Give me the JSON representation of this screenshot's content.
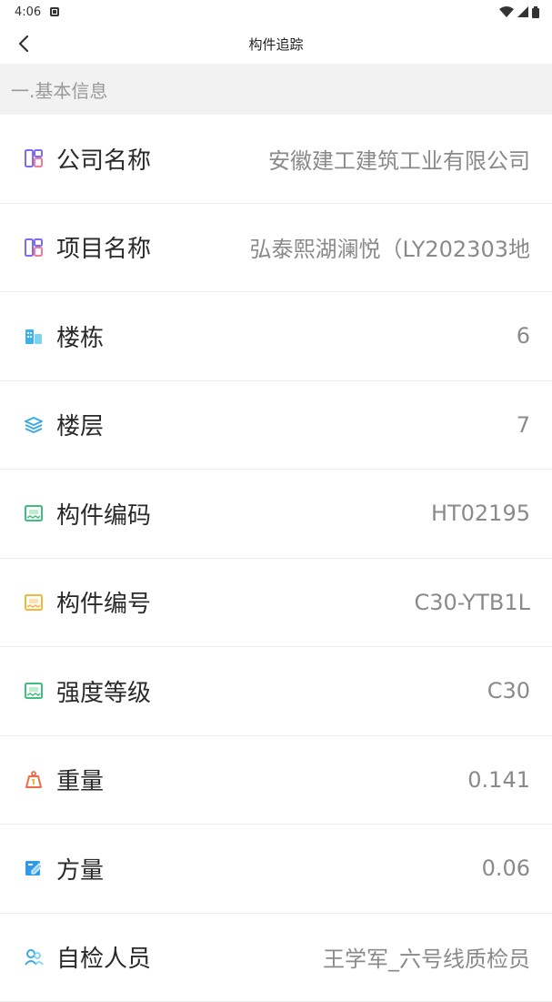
{
  "status_bar": {
    "time": "4:06"
  },
  "header": {
    "title": "构件追踪"
  },
  "section": {
    "title": "一.基本信息"
  },
  "rows": [
    {
      "label": "公司名称",
      "value": "安徽建工建筑工业有限公司",
      "icon": "layout-grid-icon",
      "color": "#7b6cf6"
    },
    {
      "label": "项目名称",
      "value": "弘泰熙湖澜悦（LY202303地",
      "icon": "layout-grid-icon",
      "color": "#7b6cf6"
    },
    {
      "label": "楼栋",
      "value": "6",
      "icon": "buildings-icon",
      "color": "#3db2e8"
    },
    {
      "label": "楼层",
      "value": "7",
      "icon": "layers-icon",
      "color": "#3aa9e6"
    },
    {
      "label": "构件编码",
      "value": "HT02195",
      "icon": "component-card-icon",
      "color": "#3fbf7f"
    },
    {
      "label": "构件编号",
      "value": "C30-YTB1L",
      "icon": "component-card-icon",
      "color": "#f5b63c"
    },
    {
      "label": "强度等级",
      "value": "C30",
      "icon": "component-card-icon",
      "color": "#3fbf7f"
    },
    {
      "label": "重量",
      "value": "0.141",
      "icon": "weight-icon",
      "color": "#f06a4a"
    },
    {
      "label": "方量",
      "value": "0.06",
      "icon": "edit-volume-icon",
      "color": "#2f9be8"
    },
    {
      "label": "自检人员",
      "value": "王学军_六号线质检员",
      "icon": "people-icon",
      "color": "#3aa9e6"
    }
  ]
}
